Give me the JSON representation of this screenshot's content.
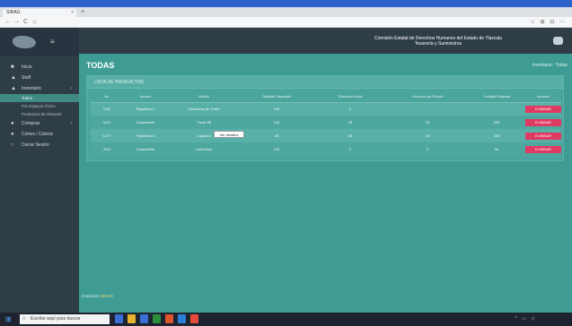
{
  "os": {
    "title": ""
  },
  "browser": {
    "tab_label": "SIRAG",
    "tab_close": "×",
    "new_tab": "+",
    "url": "",
    "search_placeholder": "",
    "back": "←",
    "forward": "→",
    "reload": "C",
    "home": "⌂",
    "toolbar_icons": "☆ ⊞ ⊡ ⋯"
  },
  "sidebar": {
    "menu_icon": "≡",
    "items": [
      {
        "label": "Inicio",
        "icon": "■"
      },
      {
        "label": "Staff",
        "icon": "▲"
      },
      {
        "label": "Inventario",
        "icon": "▲",
        "caret": "‹"
      }
    ],
    "sub_items": [
      {
        "label": "Todos",
        "active": true
      },
      {
        "label": "Por Espacio Físico",
        "active": false
      },
      {
        "label": "Productos de Almacén",
        "active": false
      }
    ],
    "items_after": [
      {
        "label": "Compras",
        "icon": "●",
        "caret": "‹"
      },
      {
        "label": "Cortes / Cobros",
        "icon": "●"
      },
      {
        "label": "Cerrar Sesión",
        "icon": "○"
      }
    ]
  },
  "header": {
    "org_line1": "Comisión Estatal de Derechos Humanos del Estado de Tlaxcala",
    "org_line2": "Tesorería y Suministros",
    "user_icon": "user-icon"
  },
  "main": {
    "page_title": "TODAS",
    "crumb_prev": "Inventario",
    "crumb_sep": "/",
    "crumb_current": "Todas",
    "panel_title": "LISTA DE PRODUCTOS",
    "columns": [
      "No.",
      "Nombre",
      "Modelo",
      "Cantidad Disponible",
      "Existencia Inicial",
      "Consumo por Periodo",
      "Cantidad Sugerida",
      "Acciones"
    ],
    "rows": [
      {
        "no": "1102",
        "nombre": "Papelería Y",
        "modelo": "Cartuchos de Tóner",
        "cant_disp": "100",
        "exist": "0",
        "consumo": "",
        "sugerida": "",
        "action": "ELIMINAR"
      },
      {
        "no": "1101",
        "nombre": "Consumible",
        "modelo": "Tóner 88",
        "cant_disp": "110",
        "exist": "15",
        "consumo": "15",
        "sugerida": "200",
        "action": "ELIMINAR"
      },
      {
        "no": "1077",
        "nombre": "Papelería 8",
        "modelo": "Lapicero",
        "cant_disp": "45",
        "exist": "35",
        "consumo": "15",
        "sugerida": "200",
        "action": "ELIMINAR"
      },
      {
        "no": "1113",
        "nombre": "Consumible",
        "modelo": "Cartuchos",
        "cant_disp": "120",
        "exist": "0",
        "consumo": "0",
        "sugerida": "18",
        "action": "ELIMINAR"
      }
    ],
    "tooltip": "Ver detalles",
    "footer_text": "Inventario",
    "footer_link": "SIRAG"
  },
  "taskbar": {
    "start_icon": "⊞",
    "search_text": "Escribe aquí para buscar",
    "search_icon": "○",
    "tray": "^ ▭ ◁",
    "time": "",
    "date": "",
    "icon_colors": [
      "#3b6fd6",
      "#e8b22e",
      "#3b6fd6",
      "#2d8f3e",
      "#e0542c",
      "#2a7ed8",
      "#e54b3a"
    ]
  }
}
